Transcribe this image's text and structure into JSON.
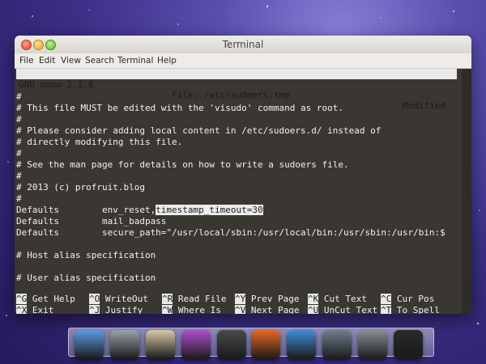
{
  "window": {
    "title": "Terminal"
  },
  "menu": [
    "File",
    "Edit",
    "View",
    "Search",
    "Terminal",
    "Help"
  ],
  "nano_header": {
    "version": "GNU nano 2.2.6",
    "file": "File: /etc/sudoers.tmp",
    "status": "Modified"
  },
  "editor_lines": [
    "#",
    "# This file MUST be edited with the 'visudo' command as root.",
    "#",
    "# Please consider adding local content in /etc/sudoers.d/ instead of",
    "# directly modifying this file.",
    "#",
    "# See the man page for details on how to write a sudoers file.",
    "#",
    "# 2013 (c) profruit.blog",
    "#",
    "",
    "Defaults        mail_badpass",
    "Defaults        secure_path=\"/usr/local/sbin:/usr/local/bin:/usr/sbin:/usr/bin:$",
    "",
    "# Host alias specification",
    "",
    "# User alias specification"
  ],
  "defaults_env_line": {
    "prefix": "Defaults        env_reset,",
    "highlighted": "timestamp_timeout=30"
  },
  "shortcuts": [
    {
      "key": "^G",
      "label": "Get Help"
    },
    {
      "key": "^O",
      "label": "WriteOut"
    },
    {
      "key": "^R",
      "label": "Read File"
    },
    {
      "key": "^Y",
      "label": "Prev Page"
    },
    {
      "key": "^K",
      "label": "Cut Text"
    },
    {
      "key": "^C",
      "label": "Cur Pos"
    },
    {
      "key": "^X",
      "label": "Exit"
    },
    {
      "key": "^J",
      "label": "Justify"
    },
    {
      "key": "^W",
      "label": "Where Is"
    },
    {
      "key": "^V",
      "label": "Next Page"
    },
    {
      "key": "^U",
      "label": "UnCut Text"
    },
    {
      "key": "^T",
      "label": "To Spell"
    }
  ],
  "dock_apps": [
    {
      "name": "finder-icon",
      "color": "#5a9be6"
    },
    {
      "name": "launchpad-icon",
      "color": "#9aa3ad"
    },
    {
      "name": "mail-icon",
      "color": "#d9c9a8"
    },
    {
      "name": "itunes-icon",
      "color": "#b04fcf"
    },
    {
      "name": "photo-booth-icon",
      "color": "#4a4a4a"
    },
    {
      "name": "firefox-icon",
      "color": "#e8681f"
    },
    {
      "name": "time-machine-icon",
      "color": "#3f8cd6"
    },
    {
      "name": "dashboard-icon",
      "color": "#6f7d8c"
    },
    {
      "name": "system-preferences-icon",
      "color": "#8a8f96"
    },
    {
      "name": "terminal-icon",
      "color": "#2a2a2a"
    }
  ]
}
